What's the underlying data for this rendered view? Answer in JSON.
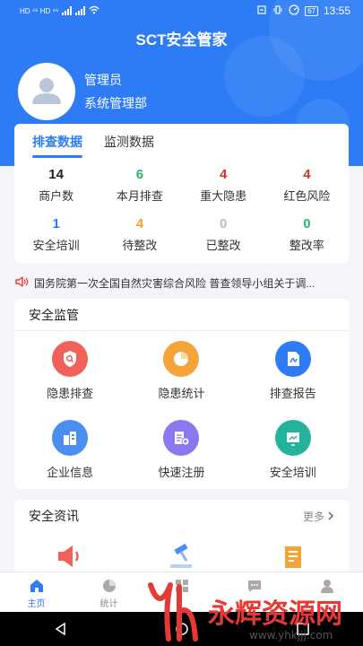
{
  "status_bar": {
    "left_indicators": "HD ⁴⁶ HD ⁴⁶",
    "battery": "67",
    "time": "13:55"
  },
  "app": {
    "title": "SCT安全管家"
  },
  "user": {
    "name": "管理员",
    "department": "系统管理部"
  },
  "stats": {
    "tabs": [
      {
        "label": "排查数据",
        "active": true
      },
      {
        "label": "监测数据",
        "active": false
      }
    ],
    "items": [
      {
        "value": "14",
        "label": "商户数",
        "color": "#222222"
      },
      {
        "value": "6",
        "label": "本月排查",
        "color": "#2fb56b"
      },
      {
        "value": "4",
        "label": "重大隐患",
        "color": "#d9342b"
      },
      {
        "value": "4",
        "label": "红色风险",
        "color": "#d9342b"
      },
      {
        "value": "1",
        "label": "安全培训",
        "color": "#2d7cf6"
      },
      {
        "value": "4",
        "label": "待整改",
        "color": "#f0a12a"
      },
      {
        "value": "0",
        "label": "已整改",
        "color": "#bbbbbb"
      },
      {
        "value": "0",
        "label": "整改率",
        "color": "#2fb56b"
      }
    ]
  },
  "notice": {
    "text": "国务院第一次全国自然灾害综合风险 普查领导小组关于调..."
  },
  "safety": {
    "title": "安全监管",
    "items": [
      {
        "label": "隐患排查",
        "icon": "search-shield-icon",
        "color": "#f2605a"
      },
      {
        "label": "隐患统计",
        "icon": "pie-chart-icon",
        "color": "#f5a43a"
      },
      {
        "label": "排查报告",
        "icon": "pdf-report-icon",
        "color": "#2d7cf6"
      },
      {
        "label": "企业信息",
        "icon": "building-icon",
        "color": "#4a8ef0"
      },
      {
        "label": "快速注册",
        "icon": "register-icon",
        "color": "#8a78f0"
      },
      {
        "label": "安全培训",
        "icon": "training-icon",
        "color": "#23b39a"
      }
    ]
  },
  "news": {
    "title": "安全资讯",
    "more": "更多",
    "icons": [
      "speaker-icon",
      "gavel-icon",
      "document-icon"
    ]
  },
  "bottom_nav": [
    {
      "label": "主页",
      "icon": "home-icon",
      "active": true
    },
    {
      "label": "统计",
      "icon": "chart-icon",
      "active": false
    },
    {
      "label": "",
      "icon": "apps-icon",
      "active": false
    },
    {
      "label": "",
      "icon": "message-icon",
      "active": false
    },
    {
      "label": "",
      "icon": "user-icon",
      "active": false
    }
  ],
  "watermark": {
    "text": "永辉资源网",
    "url": "www.yhkjjj.com"
  }
}
